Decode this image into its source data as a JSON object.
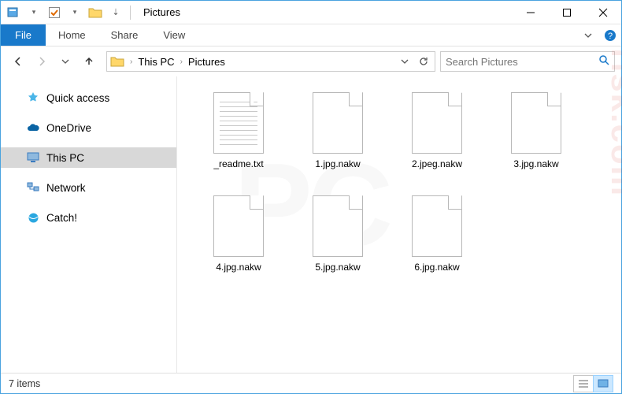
{
  "titlebar": {
    "title": "Pictures"
  },
  "window_controls": {
    "minimize": "min",
    "maximize": "max",
    "close": "close"
  },
  "ribbon": {
    "file": "File",
    "tabs": [
      "Home",
      "Share",
      "View"
    ]
  },
  "nav": {
    "back": "←",
    "forward": "→",
    "recent": "▾",
    "up": "↑"
  },
  "breadcrumbs": {
    "items": [
      {
        "label": "This PC"
      },
      {
        "label": "Pictures"
      }
    ]
  },
  "search": {
    "placeholder": "Search Pictures"
  },
  "sidebar": {
    "items": [
      {
        "id": "quick-access",
        "label": "Quick access",
        "icon": "star",
        "color": "#2aa7e0"
      },
      {
        "id": "onedrive",
        "label": "OneDrive",
        "icon": "cloud",
        "color": "#0a64a4"
      },
      {
        "id": "this-pc",
        "label": "This PC",
        "icon": "monitor",
        "color": "#3a7bbf",
        "selected": true
      },
      {
        "id": "network",
        "label": "Network",
        "icon": "network",
        "color": "#3a7bbf"
      },
      {
        "id": "catch",
        "label": "Catch!",
        "icon": "ball",
        "color": "#1e88e5"
      }
    ]
  },
  "files": [
    {
      "name": "_readme.txt",
      "kind": "text"
    },
    {
      "name": "1.jpg.nakw",
      "kind": "blank"
    },
    {
      "name": "2.jpeg.nakw",
      "kind": "blank"
    },
    {
      "name": "3.jpg.nakw",
      "kind": "blank"
    },
    {
      "name": "4.jpg.nakw",
      "kind": "blank"
    },
    {
      "name": "5.jpg.nakw",
      "kind": "blank"
    },
    {
      "name": "6.jpg.nakw",
      "kind": "blank"
    }
  ],
  "status": {
    "count_label": "7 items"
  },
  "view": {
    "details": "details",
    "icons": "icons",
    "active": "icons"
  }
}
